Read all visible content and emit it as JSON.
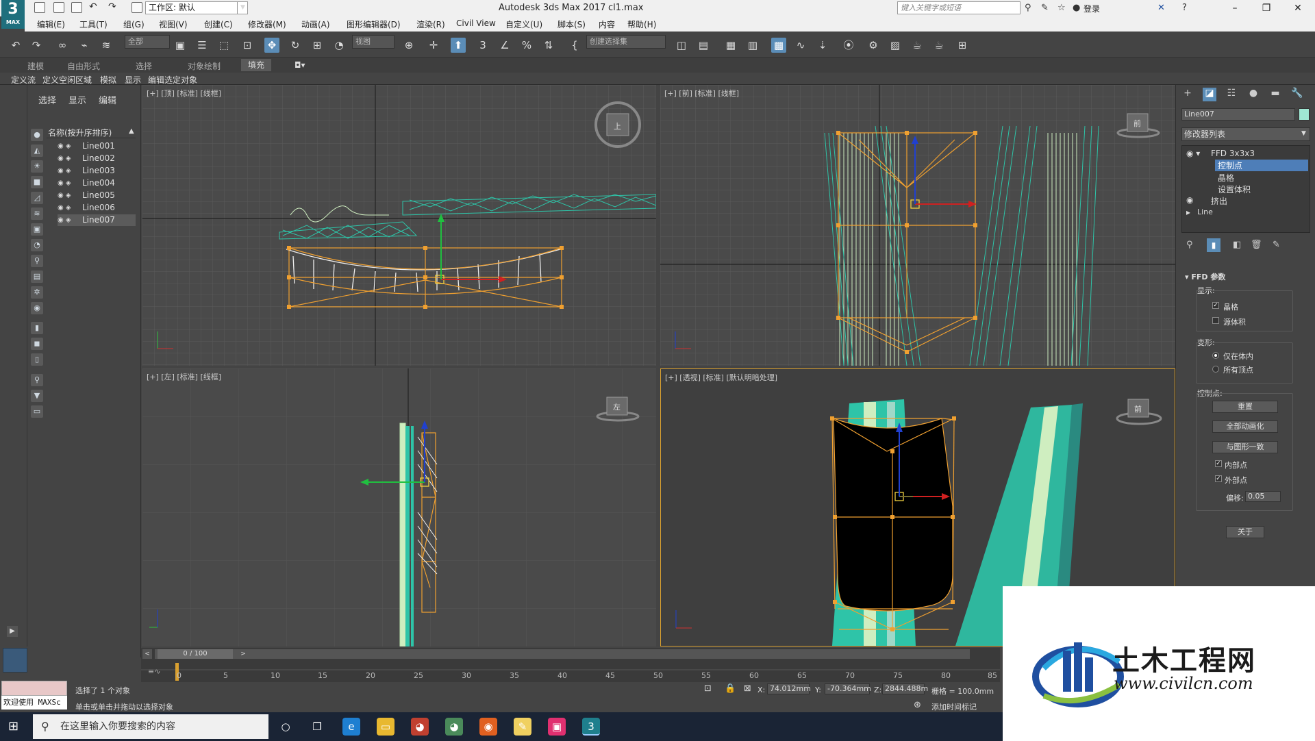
{
  "title_bar": {
    "logo_number": "3",
    "logo_text": "MAX",
    "workspace": "工作区: 默认",
    "app_title": "Autodesk 3ds Max 2017",
    "file_name": "cl1.max",
    "search_placeholder": "键入关键字或短语",
    "login": "登录"
  },
  "menu": [
    "编辑(E)",
    "工具(T)",
    "组(G)",
    "视图(V)",
    "创建(C)",
    "修改器(M)",
    "动画(A)",
    "图形编辑器(D)",
    "渲染(R)",
    "Civil View",
    "自定义(U)",
    "脚本(S)",
    "内容",
    "帮助(H)"
  ],
  "toolbar": {
    "selection_filter": "全部",
    "ref_coord": "视图",
    "named_selection": "创建选择集"
  },
  "ribbon_tabs": [
    "建模",
    "自由形式",
    "选择",
    "对象绘制",
    "填充"
  ],
  "ribbon_sub": [
    "定义流",
    "定义空闲区域",
    "模拟",
    "显示",
    "编辑选定对象"
  ],
  "scene_explorer": {
    "tabs": [
      "选择",
      "显示",
      "编辑"
    ],
    "column_header": "名称(按升序排序)",
    "items": [
      "Line001",
      "Line002",
      "Line003",
      "Line004",
      "Line005",
      "Line006",
      "Line007"
    ],
    "selected": "Line007"
  },
  "viewports": {
    "top": "[+] [顶] [标准] [线框]",
    "front": "[+] [前] [标准] [线框]",
    "left": "[+] [左] [标准] [线框]",
    "persp": "[+] [透视] [标准] [默认明暗处理]",
    "cube_top": "上",
    "cube_front": "前",
    "cube_left": "左",
    "cube_persp": "前"
  },
  "command_panel": {
    "object_name": "Line007",
    "object_color": "#9fe8d3",
    "modifier_list": "修改器列表",
    "stack": {
      "ffd": "FFD 3x3x3",
      "control_points": "控制点",
      "lattice": "晶格",
      "set_volume": "设置体积",
      "extrude": "挤出",
      "line": "Line"
    },
    "ffd_params": "FFD 参数",
    "display_label": "显示:",
    "lattice_cb": "晶格",
    "source_volume_cb": "源体积",
    "deform_label": "变形:",
    "only_in_volume": "仅在体内",
    "all_vertices": "所有顶点",
    "control_points_label": "控制点:",
    "reset_btn": "重置",
    "animate_all_btn": "全部动画化",
    "conform_btn": "与图形一致",
    "inside_points": "内部点",
    "outside_points": "外部点",
    "offset_label": "偏移:",
    "offset_value": "0.05",
    "about_btn": "关于"
  },
  "time_slider": {
    "label": "0 / 100",
    "ticks": [
      "0",
      "5",
      "10",
      "15",
      "20",
      "25",
      "30",
      "35",
      "40",
      "45",
      "50",
      "55",
      "60",
      "65",
      "70",
      "75",
      "80",
      "85"
    ]
  },
  "status": {
    "welcome": "欢迎使用 MAXSc",
    "selected": "选择了 1 个对象",
    "prompt": "单击或单击并拖动以选择对象",
    "x_label": "X:",
    "x_value": "74.012mm",
    "y_label": "Y:",
    "y_value": "-70.364mm",
    "z_label": "Z:",
    "z_value": "2844.488m",
    "grid": "栅格 = 100.0mm",
    "add_time_tag": "添加时间标记"
  },
  "taskbar": {
    "search_placeholder": "在这里输入你要搜索的内容"
  },
  "watermark": {
    "title": "土木工程网",
    "url": "www.civilcn.com"
  },
  "colors": {
    "accent_blue": "#5b8db7",
    "selection_orange": "#f0a030",
    "mesh_teal": "#2ec4a8",
    "mesh_light": "#cfeec0"
  }
}
